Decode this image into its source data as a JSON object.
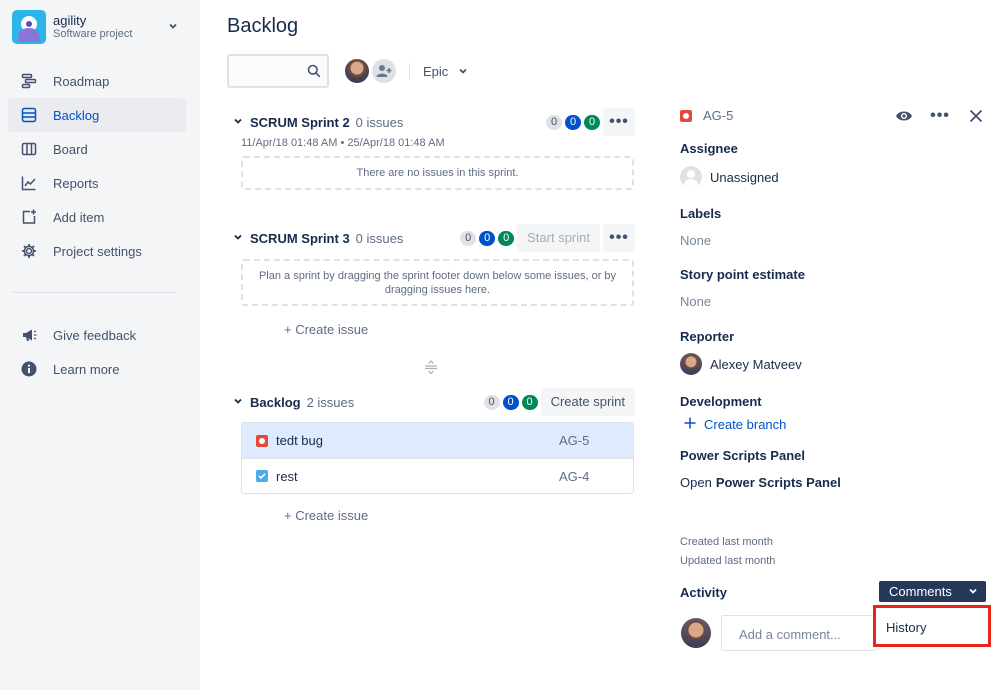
{
  "project": {
    "name": "agility",
    "type": "Software project"
  },
  "nav": {
    "items": [
      {
        "label": "Roadmap",
        "icon": "roadmap-icon"
      },
      {
        "label": "Backlog",
        "icon": "backlog-icon",
        "active": true
      },
      {
        "label": "Board",
        "icon": "board-icon"
      },
      {
        "label": "Reports",
        "icon": "reports-icon"
      },
      {
        "label": "Add item",
        "icon": "add-item-icon"
      },
      {
        "label": "Project settings",
        "icon": "gear-icon"
      }
    ],
    "secondary": [
      {
        "label": "Give feedback",
        "icon": "megaphone-icon"
      },
      {
        "label": "Learn more",
        "icon": "info-icon"
      }
    ]
  },
  "main": {
    "title": "Backlog",
    "search_placeholder": "",
    "epic_filter": "Epic"
  },
  "sprints": [
    {
      "name": "SCRUM Sprint 2",
      "count": "0 issues",
      "dates": "11/Apr/18 01:48 AM • 25/Apr/18 01:48 AM",
      "badges": [
        "0",
        "0",
        "0"
      ],
      "empty_text": "There are no issues in this sprint."
    },
    {
      "name": "SCRUM Sprint 3",
      "count": "0 issues",
      "badges": [
        "0",
        "0",
        "0"
      ],
      "action": "Start sprint",
      "empty_text": "Plan a sprint by dragging the sprint footer down below some issues, or by dragging issues here.",
      "create_issue": "+ Create issue"
    }
  ],
  "backlog": {
    "name": "Backlog",
    "count": "2 issues",
    "badges": [
      "0",
      "0",
      "0"
    ],
    "action": "Create sprint",
    "issues": [
      {
        "summary": "tedt bug",
        "key": "AG-5",
        "type": "bug",
        "selected": true
      },
      {
        "summary": "rest",
        "key": "AG-4",
        "type": "task"
      }
    ],
    "create_issue": "+ Create issue"
  },
  "detail": {
    "key": "AG-5",
    "assignee_label": "Assignee",
    "assignee_value": "Unassigned",
    "labels_label": "Labels",
    "labels_value": "None",
    "story_points_label": "Story point estimate",
    "story_points_value": "None",
    "reporter_label": "Reporter",
    "reporter_value": "Alexey Matveev",
    "development_label": "Development",
    "create_branch": "Create branch",
    "power_scripts_label": "Power Scripts Panel",
    "open_prefix": "Open",
    "open_panel": "Power Scripts Panel",
    "created": "Created last month",
    "updated": "Updated last month",
    "activity_label": "Activity",
    "activity_select": "Comments",
    "activity_option": "History",
    "comment_placeholder": "Add a comment..."
  },
  "colors": {
    "accent": "#0052cc",
    "sidebar_bg": "#f4f5f7",
    "selected_row": "#deebff",
    "bug": "#e5493a",
    "task": "#4bade8",
    "highlight": "#e8251b"
  }
}
